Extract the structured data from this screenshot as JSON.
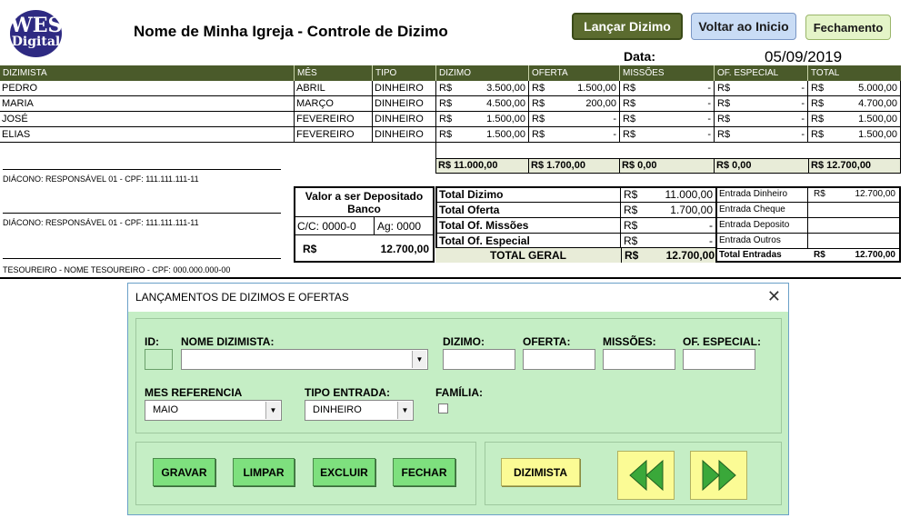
{
  "logo": {
    "line1": "WES",
    "line2": "Digital"
  },
  "title": "Nome de Minha Igreja - Controle de Dizimo",
  "buttons": {
    "lancar": "Lançar Dizimo",
    "voltar": "Voltar ao Inicio",
    "fechamento": "Fechamento"
  },
  "date": {
    "label": "Data:",
    "value": "05/09/2019"
  },
  "table": {
    "headers": [
      "DIZIMISTA",
      "MÊS REFERENCIA",
      "TIPO",
      "DIZIMO",
      "OFERTA",
      "MISSÕES",
      "OF. ESPECIAL",
      "TOTAL"
    ],
    "rows": [
      {
        "nome": "PEDRO",
        "mes": "ABRIL",
        "tipo": "DINHEIRO",
        "dizimo": "3.500,00",
        "oferta": "1.500,00",
        "missoes": "-",
        "especial": "-",
        "total": "5.000,00"
      },
      {
        "nome": "MARIA",
        "mes": "MARÇO",
        "tipo": "DINHEIRO",
        "dizimo": "4.500,00",
        "oferta": "200,00",
        "missoes": "-",
        "especial": "-",
        "total": "4.700,00"
      },
      {
        "nome": "JOSÉ",
        "mes": "FEVEREIRO",
        "tipo": "DINHEIRO",
        "dizimo": "1.500,00",
        "oferta": "-",
        "missoes": "-",
        "especial": "-",
        "total": "1.500,00"
      },
      {
        "nome": "ELIAS",
        "mes": "FEVEREIRO",
        "tipo": "DINHEIRO",
        "dizimo": "1.500,00",
        "oferta": "-",
        "missoes": "-",
        "especial": "-",
        "total": "1.500,00"
      }
    ],
    "currency": "R$",
    "totals": {
      "dizimo": "R$ 11.000,00",
      "oferta": "R$ 1.700,00",
      "missoes": "R$ 0,00",
      "especial": "R$ 0,00",
      "total": "R$ 12.700,00"
    }
  },
  "signatures": [
    "DIÁCONO: RESPONSÁVEL 01 - CPF: 111.111.111-11",
    "DIÁCONO: RESPONSÁVEL 01 - CPF: 111.111.111-11",
    "TESOUREIRO - NOME TESOUREIRO - CPF: 000.000.000-00"
  ],
  "deposit": {
    "title": "Valor a ser Depositado",
    "subtitle": "Banco",
    "cc": "C/C: 0000-0",
    "ag": "Ag: 0000",
    "currency": "R$",
    "value": "12.700,00"
  },
  "summary": [
    {
      "label": "Total Dizimo",
      "value": "11.000,00"
    },
    {
      "label": "Total Oferta",
      "value": "1.700,00"
    },
    {
      "label": "Total Of. Missões",
      "value": "-"
    },
    {
      "label": "Total Of. Especial",
      "value": "-"
    }
  ],
  "total_geral": {
    "label": "TOTAL GERAL",
    "value": "12.700,00"
  },
  "entradas": [
    {
      "label": "Entrada Dinheiro",
      "value": "12.700,00",
      "cur": "R$"
    },
    {
      "label": "Entrada Cheque",
      "value": "",
      "cur": ""
    },
    {
      "label": "Entrada Deposito",
      "value": "",
      "cur": ""
    },
    {
      "label": "Entrada Outros",
      "value": "",
      "cur": ""
    }
  ],
  "total_entradas": {
    "label": "Total Entradas",
    "cur": "R$",
    "value": "12.700,00"
  },
  "dialog": {
    "title": "LANÇAMENTOS DE DIZIMOS E OFERTAS",
    "close": "✕",
    "labels": {
      "id": "ID:",
      "nome": "NOME DIZIMISTA:",
      "dizimo": "DIZIMO:",
      "oferta": "OFERTA:",
      "missoes": "MISSÕES:",
      "especial": "OF. ESPECIAL:",
      "mes": "MES REFERENCIA",
      "tipo": "TIPO ENTRADA:",
      "familia": "FAMÍLIA:"
    },
    "mes_value": "MAIO",
    "tipo_value": "DINHEIRO",
    "actions": {
      "gravar": "GRAVAR",
      "limpar": "LIMPAR",
      "excluir": "EXCLUIR",
      "fechar": "FECHAR",
      "dizimista": "DIZIMISTA"
    }
  },
  "colors": {
    "header_bg": "#4a5a2a",
    "dialog_bg": "#c5eec5",
    "green_button": "#7ee07e",
    "yellow_button": "#fbfb95",
    "nav_arrow": "#3aa83a"
  }
}
